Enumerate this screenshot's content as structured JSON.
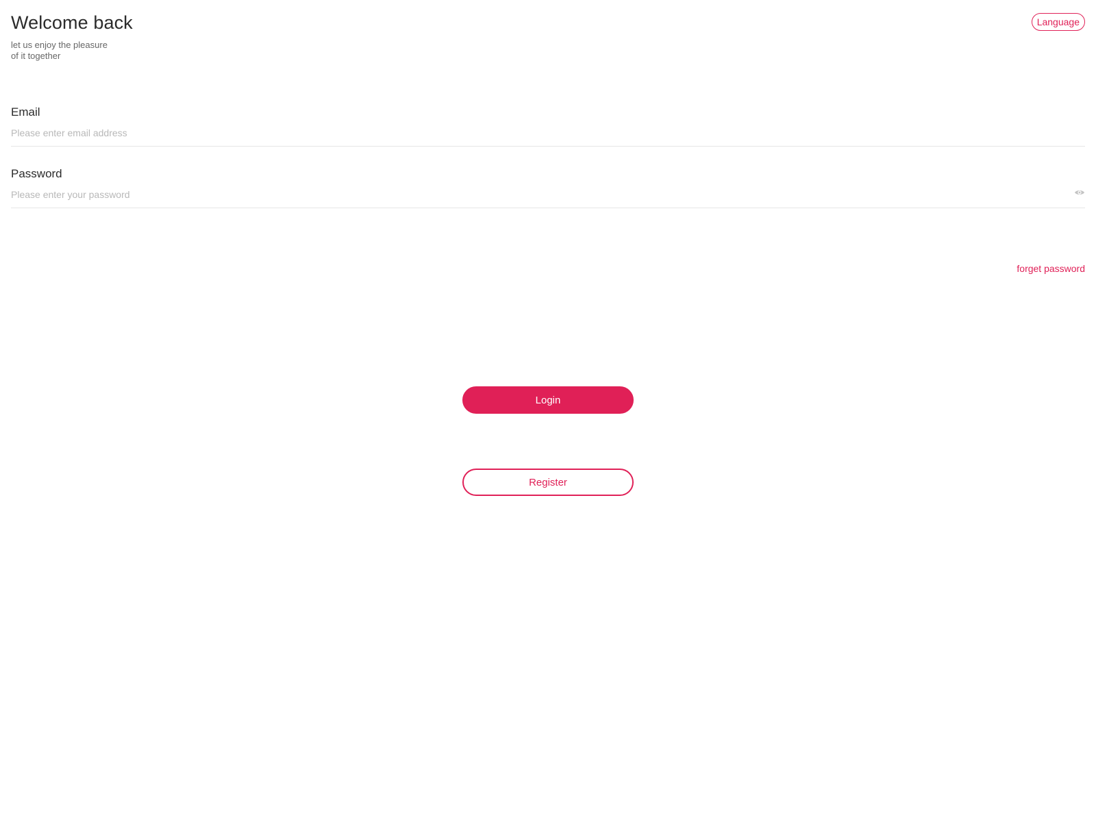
{
  "header": {
    "title": "Welcome back",
    "subtitle_line1": "let us enjoy the pleasure",
    "subtitle_line2": "of it together",
    "language_label": "Language"
  },
  "form": {
    "email": {
      "label": "Email",
      "placeholder": "Please enter email address",
      "value": ""
    },
    "password": {
      "label": "Password",
      "placeholder": "Please enter your password",
      "value": "",
      "toggle_icon": "eye-icon"
    },
    "forget_password_label": "forget password"
  },
  "actions": {
    "login_label": "Login",
    "register_label": "Register"
  },
  "colors": {
    "accent": "#e02057",
    "text": "#2b2b2b",
    "placeholder": "#b8b8b8",
    "divider": "#e6e6e6"
  }
}
